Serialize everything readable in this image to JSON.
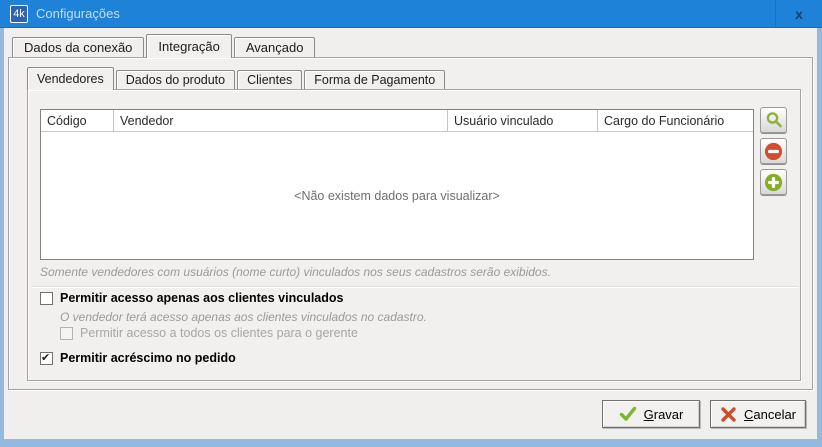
{
  "window": {
    "title": "Configurações",
    "app_icon_text": "4k",
    "close_glyph": "x"
  },
  "main_tabs": [
    {
      "label": "Dados da conexão",
      "active": false
    },
    {
      "label": "Integração",
      "active": true
    },
    {
      "label": "Avançado",
      "active": false
    }
  ],
  "sub_tabs": [
    {
      "label": "Vendedores",
      "active": true
    },
    {
      "label": "Dados do produto",
      "active": false
    },
    {
      "label": "Clientes",
      "active": false
    },
    {
      "label": "Forma de Pagamento",
      "active": false
    }
  ],
  "grid": {
    "columns": [
      "Código",
      "Vendedor",
      "Usuário vinculado",
      "Cargo do Funcionário"
    ],
    "rows": [],
    "empty_message": "<Não existem dados para visualizar>"
  },
  "side_buttons": [
    {
      "icon": "search-icon",
      "color": "#8fb040"
    },
    {
      "icon": "remove-icon",
      "color": "#d14f2e"
    },
    {
      "icon": "add-icon",
      "color": "#84ad28"
    }
  ],
  "note": "Somente vendedores com usuários (nome curto) vinculados nos seus cadastros serão exibidos.",
  "options": {
    "allow_linked_clients": {
      "label": "Permitir acesso apenas aos clientes vinculados",
      "checked": false
    },
    "linked_clients_note": "O vendedor terá acesso apenas aos clientes vinculados no cadastro.",
    "manager_all_clients": {
      "label": "Permitir acesso a todos os clientes para o gerente",
      "checked": false,
      "disabled": true
    },
    "allow_order_increase": {
      "label": "Permitir acréscimo no pedido",
      "checked": true
    }
  },
  "footer": {
    "save_key": "G",
    "save_rest": "ravar",
    "cancel_key": "C",
    "cancel_rest": "ancelar"
  },
  "colors": {
    "titlebar": "#1e82d8",
    "frame": "#93b9de",
    "accent_green": "#84ad28",
    "accent_red": "#d14f2e",
    "search_olive": "#8fb040",
    "save_check": "#7ab82c",
    "cancel_cross": "#c8502e"
  }
}
